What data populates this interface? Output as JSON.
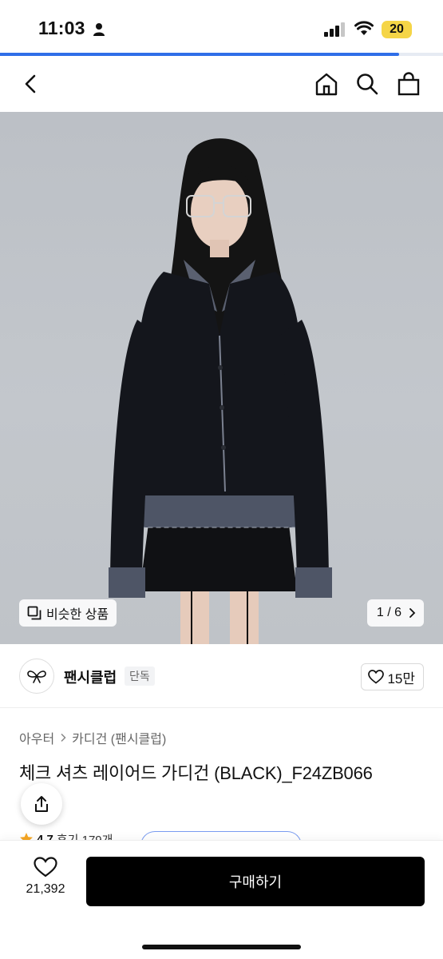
{
  "status_bar": {
    "time": "11:03",
    "battery": "20",
    "page_load_fraction": 0.9
  },
  "nav": {
    "icons": [
      "chevron-left-icon",
      "home-icon",
      "search-icon",
      "shopping-bag-icon"
    ]
  },
  "gallery": {
    "similar_label": "비슷한 상품",
    "page_indicator": "1 / 6",
    "colors": {
      "background": "#c0c4c9",
      "cardigan": "#14161c"
    }
  },
  "brand": {
    "name": "팬시클럽",
    "badge": "단독",
    "likes": "15만"
  },
  "breadcrumb": {
    "category": "아우터",
    "subcategory": "카디건 (팬시클럽)"
  },
  "product": {
    "title": "체크 셔츠 레이어드 가디건 (BLACK)_F24ZB066",
    "rating": "4.7",
    "reviews": "후기 179개"
  },
  "bottom_bar": {
    "wishlist_count": "21,392",
    "buy_label": "구매하기"
  },
  "colors": {
    "accent": "#2f6ee8",
    "buy_button": "#000000",
    "star": "#f5a623",
    "battery": "#f5d547"
  }
}
